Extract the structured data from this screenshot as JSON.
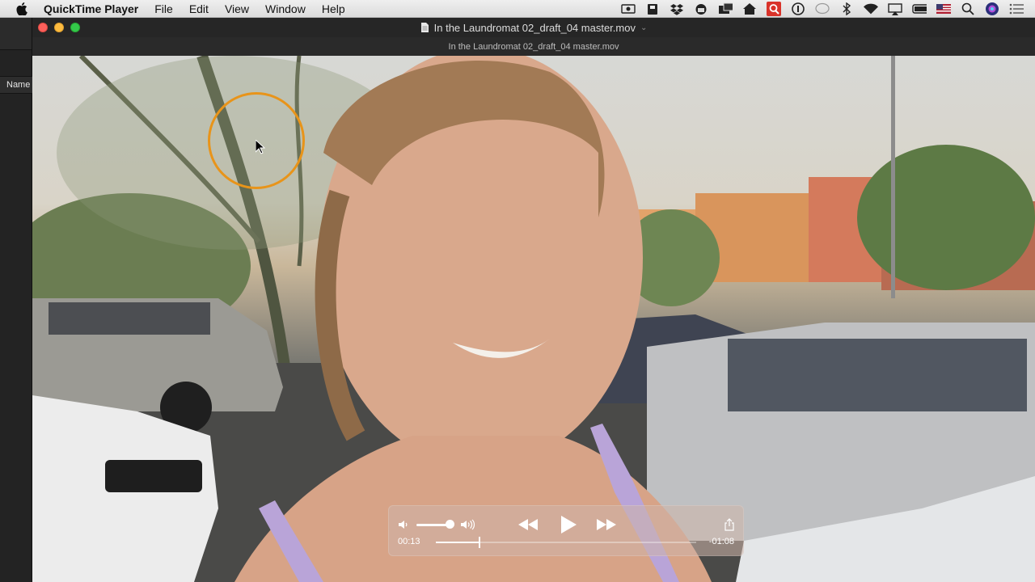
{
  "menubar": {
    "app_name": "QuickTime Player",
    "menus": [
      "File",
      "Edit",
      "View",
      "Window",
      "Help"
    ],
    "status_icons": [
      "screen-record-icon",
      "book-icon",
      "dropbox-icon",
      "camera-icon",
      "box-icon",
      "home-icon",
      "qr-icon",
      "info-icon",
      "chat-icon",
      "bluetooth-icon",
      "wifi-icon",
      "airplay-icon",
      "battery-icon",
      "flag-icon",
      "search-icon",
      "siri-icon",
      "list-icon"
    ]
  },
  "background_window": {
    "column_header": "Name"
  },
  "window": {
    "title": "In the Laundromat 02_draft_04 master.mov",
    "subtitle": "In the Laundromat 02_draft_04 master.mov"
  },
  "player": {
    "time_elapsed": "00:13",
    "time_remaining": "-01:08",
    "progress": 0.167,
    "volume": 0.85
  },
  "colors": {
    "cursor_ring": "#e8941a",
    "close": "#fc605b",
    "minimize": "#fdbc40",
    "maximize": "#34c84a"
  }
}
